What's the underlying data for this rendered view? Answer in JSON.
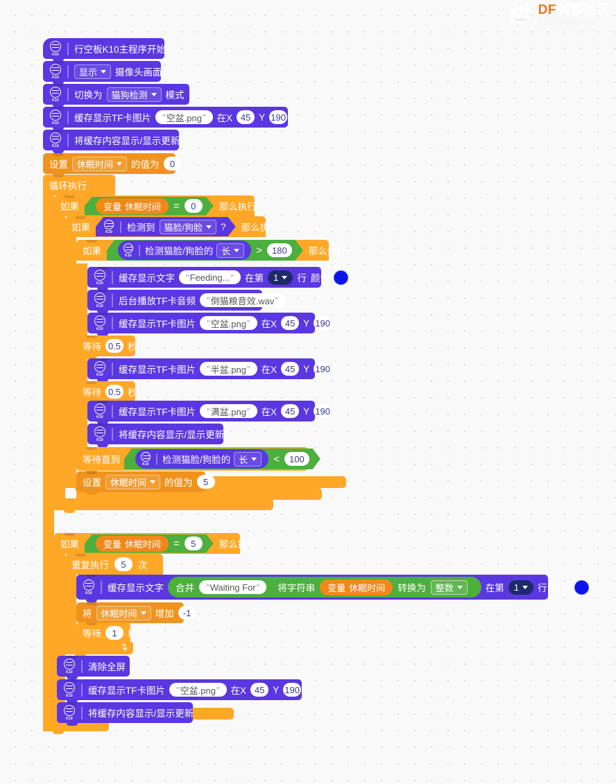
{
  "watermark": {
    "brand": "DF",
    "brand_cn": "创客社区",
    "site": "mc.DFRobot.com.cn"
  },
  "board": {
    "icon_label": "K10"
  },
  "blocks": {
    "start": {
      "label": "行空板K10主程序开始"
    },
    "display_camera": {
      "dropdown": "显示",
      "label": "摄像头画面"
    },
    "switch_mode": {
      "prefix": "切换为",
      "dropdown": "猫狗检测",
      "suffix": "模式"
    },
    "show_img_1": {
      "prefix": "缓存显示TF卡图片",
      "file": "空盆.png",
      "x_label": "在X",
      "x": "45",
      "y_label": "Y",
      "y": "190"
    },
    "refresh_1": {
      "label": "将缓存内容显示/显示更新"
    },
    "set_var_0": {
      "prefix": "设置",
      "var": "休眠时间",
      "suffix": "的值为",
      "value": "0"
    },
    "forever": {
      "label": "循环执行"
    },
    "if_sleep_eq_0": {
      "if": "如果",
      "var_prefix": "变量",
      "var": "休眠时间",
      "op": "=",
      "value": "0",
      "then": "那么执行"
    },
    "if_detect_face": {
      "if": "如果",
      "prefix": "检测到",
      "dropdown": "猫脸/狗脸",
      "q": "?",
      "then": "那么执行"
    },
    "if_len_gt_180": {
      "if": "如果",
      "prefix": "检测猫脸/狗脸的",
      "dropdown": "长",
      "op": ">",
      "value": "180",
      "then": "那么执行"
    },
    "show_text_feeding": {
      "prefix": "缓存显示文字",
      "text": "Feeding...",
      "at": "在第",
      "line": "1",
      "row": "行",
      "color_label": "颜色",
      "color": "#0b15e8"
    },
    "play_audio": {
      "prefix": "后台播放TF卡音频",
      "file": "倒猫粮音效.wav"
    },
    "show_img_2": {
      "prefix": "缓存显示TF卡图片",
      "file": "空盆.png",
      "x_label": "在X",
      "x": "45",
      "y_label": "Y",
      "y": "190"
    },
    "wait_1": {
      "prefix": "等待",
      "value": "0.5",
      "suffix": "秒"
    },
    "show_img_3": {
      "prefix": "缓存显示TF卡图片",
      "file": "半盆.png",
      "x_label": "在X",
      "x": "45",
      "y_label": "Y",
      "y": "190"
    },
    "wait_2": {
      "prefix": "等待",
      "value": "0.5",
      "suffix": "秒"
    },
    "show_img_4": {
      "prefix": "缓存显示TF卡图片",
      "file": "满盆.png",
      "x_label": "在X",
      "x": "45",
      "y_label": "Y",
      "y": "190"
    },
    "refresh_2": {
      "label": "将缓存内容显示/显示更新"
    },
    "wait_until": {
      "prefix": "等待直到",
      "sensor": "检测猫脸/狗脸的",
      "dropdown": "长",
      "op": "<",
      "value": "100"
    },
    "set_var_5": {
      "prefix": "设置",
      "var": "休眠时间",
      "suffix": "的值为",
      "value": "5"
    },
    "if_sleep_eq_5": {
      "if": "如果",
      "var_prefix": "变量",
      "var": "休眠时间",
      "op": "=",
      "value": "5",
      "then": "那么执行"
    },
    "repeat_5": {
      "prefix": "重复执行",
      "value": "5",
      "suffix": "次"
    },
    "show_text_waiting": {
      "prefix": "缓存显示文字",
      "join": "合并",
      "text": "Waiting For ",
      "cast_prefix": "将字符串",
      "var_prefix": "变量",
      "var": "休眠时间",
      "cast_mid": "转换为",
      "cast_type": "整数",
      "at": "在第",
      "line": "1",
      "row": "行",
      "color_label": "颜色",
      "color": "#0b15e8"
    },
    "change_var": {
      "prefix": "将",
      "var": "休眠时间",
      "suffix": "增加",
      "value": "-1"
    },
    "wait_3": {
      "prefix": "等待",
      "value": "1",
      "suffix": "秒"
    },
    "clear_screen": {
      "label": "清除全屏"
    },
    "show_img_5": {
      "prefix": "缓存显示TF卡图片",
      "file": "空盆.png",
      "x_label": "在X",
      "x": "45",
      "y_label": "Y",
      "y": "190"
    },
    "refresh_3": {
      "label": "将缓存内容显示/显示更新"
    }
  },
  "palette": {
    "board_purple": "#5a37e0",
    "control_orange": "#ffa726",
    "variable_orange": "#f0931e",
    "operator_green": "#4caf3e",
    "loop_arrow": "↴"
  }
}
